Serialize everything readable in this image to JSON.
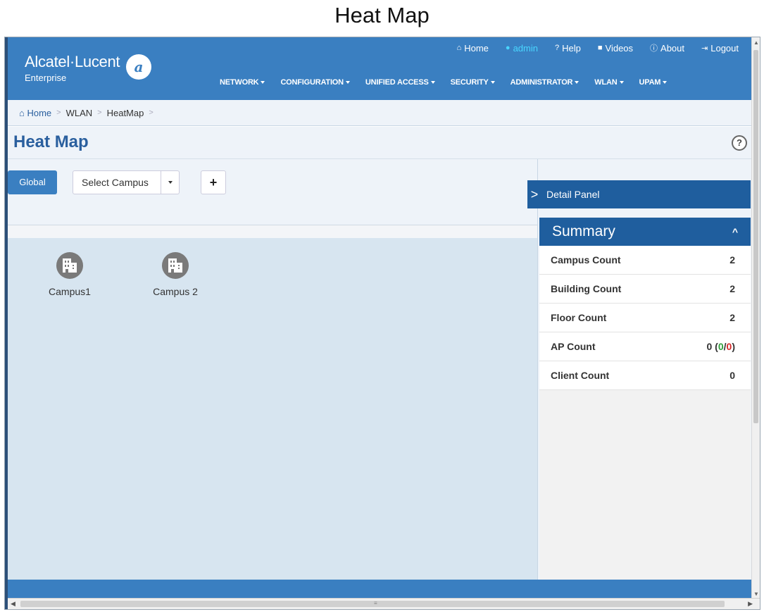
{
  "page": {
    "caption": "Heat Map"
  },
  "brand": {
    "name": "Alcatel·Lucent",
    "subtitle": "Enterprise",
    "logo_glyph": "a"
  },
  "topbar": [
    {
      "label": "Home",
      "icon": "home-icon",
      "glyph": "⌂"
    },
    {
      "label": "admin",
      "icon": "user-icon",
      "glyph": "●"
    },
    {
      "label": "Help",
      "icon": "help-icon",
      "glyph": "?"
    },
    {
      "label": "Videos",
      "icon": "video-icon",
      "glyph": "■"
    },
    {
      "label": "About",
      "icon": "info-icon",
      "glyph": "ⓘ"
    },
    {
      "label": "Logout",
      "icon": "logout-icon",
      "glyph": "⇥"
    }
  ],
  "mainnav": [
    "NETWORK",
    "CONFIGURATION",
    "UNIFIED ACCESS",
    "SECURITY",
    "ADMINISTRATOR",
    "WLAN",
    "UPAM"
  ],
  "breadcrumb": {
    "home": "Home",
    "items": [
      "WLAN",
      "HeatMap"
    ]
  },
  "title": "Heat Map",
  "help_glyph": "?",
  "toolbar": {
    "global_label": "Global",
    "select_placeholder": "Select Campus",
    "add_glyph": "+"
  },
  "campuses": [
    {
      "label": "Campus1"
    },
    {
      "label": "Campus 2"
    }
  ],
  "detail_panel": {
    "tab_glyph": ">",
    "title": "Detail Panel"
  },
  "summary": {
    "title": "Summary",
    "chevron": "^",
    "rows": [
      {
        "label": "Campus Count",
        "value": "2"
      },
      {
        "label": "Building Count",
        "value": "2"
      },
      {
        "label": "Floor Count",
        "value": "2"
      },
      {
        "label": "AP Count",
        "value": "0",
        "up": "0",
        "down": "0"
      },
      {
        "label": "Client Count",
        "value": "0"
      }
    ]
  },
  "colors": {
    "header": "#3a7fc1",
    "panel_dark": "#1f5e9e",
    "ap_up": "#2e9e3a",
    "ap_down": "#d42a2a"
  }
}
